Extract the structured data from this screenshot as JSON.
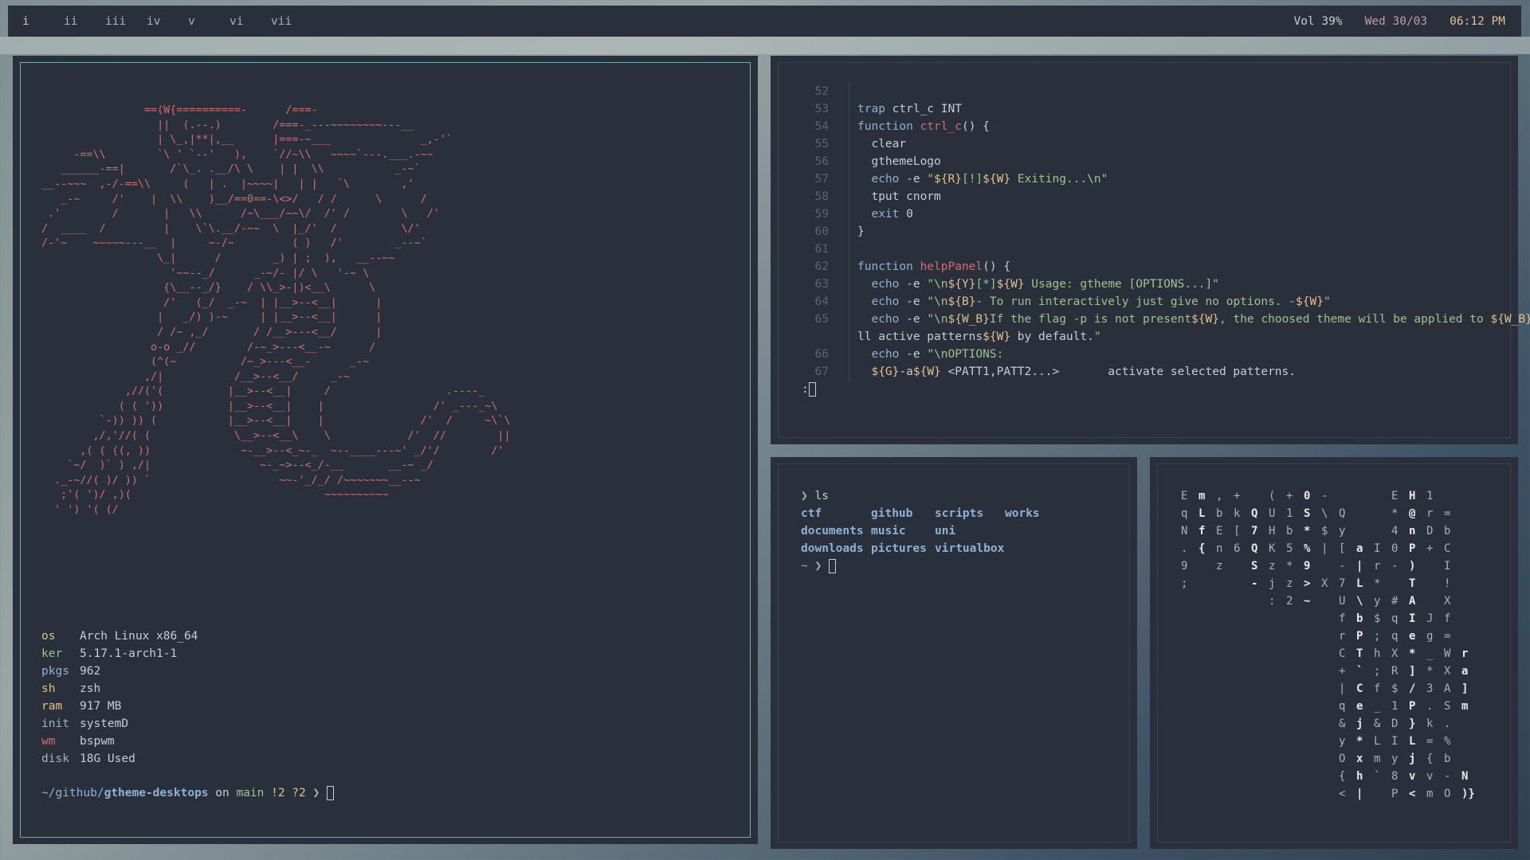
{
  "bar": {
    "workspaces": [
      "i",
      "ii",
      "iii",
      "iv",
      "v",
      "vi",
      "vii"
    ],
    "active_workspace": "i",
    "volume": "Vol 39%",
    "date": "Wed 30/03",
    "time": "06:12 PM"
  },
  "colors": {
    "accent_red": "#d36b73",
    "accent_yellow": "#e2c08d",
    "accent_blue": "#8fb1d4",
    "accent_green": "#9fc28a",
    "bg": "#29303b"
  },
  "fetch": {
    "ascii_art": "                ==(W{==========-      /===-\n                  ||  (.--.)        /===-_---~~~~~~~~---__\n                  | \\_,|**|,__      |===-~___              _,-'`\n     -==\\\\        `\\ ' `--'   ),    `//~\\\\   ~~~~`---.___.-~~\n   ______-==|       /`\\_. .__/\\ \\    | |  \\\\           _-~`\n__--~~~  ,-/-==\\\\     (   | .  |~~~~|   | |   `\\        ,'\n   _-~     /'    |  \\\\    )__/==0==-\\<>/   / /      \\      /\n .'        /       |   \\\\      /~\\___/~~\\/  /' /        \\   /'\n/  ____  /         |    \\`\\.__/-~~  \\  |_/'  /          \\/'\n/-'~    ~~~~~---__  |     ~-/~         ( )   /'        _--~`\n                  \\_|      /        _) | ;  ),   __--~~\n                    '~~--_/      _-~/- |/ \\   '-~ \\\n                   {\\__--_/}    / \\\\_>-|)<__\\      \\\n                   /'   (_/  _-~  | |__>--<__|      |\n                  |   _/) )-~     | |__>--<__|      |\n                  / /~ ,_/       / /__>---<__/      |\n                 o-o _//        /-~_>---<__-~      /\n                 (^(~          /~_>---<__-      _-~\n                ,/|           /__>--<__/     _-~\n             ,//('(          |__>--<__|     /                  .----_\n            ( ( '))          |__>--<__|    |                 /' _---_~\\\n         `-)) )) (           |__>--<__|    |               /'  /     ~\\`\\\n        ,/,'//( (             \\__>--<__\\    \\            /'  //        ||\n      ,( ( ((, ))              ~-__>--<_~-_  ~--____---~' _/'/        /'\n    `~/  )` ) ,/|                 ~-_~>--<_/-__       __-~ _/\n  ._-~//( )/ )) `                    ~~-'_/_/ /~~~~~~~__--~\n   ;'( ')/ ,)(                              ~~~~~~~~~~\n  ' ') '( (/",
    "rows": [
      {
        "key": "os",
        "value": "Arch Linux x86_64"
      },
      {
        "key": "ker",
        "value": "5.17.1-arch1-1"
      },
      {
        "key": "pkgs",
        "value": "962"
      },
      {
        "key": "sh",
        "value": "zsh"
      },
      {
        "key": "ram",
        "value": "917 MB"
      },
      {
        "key": "init",
        "value": "systemD"
      },
      {
        "key": "wm",
        "value": "bspwm"
      },
      {
        "key": "disk",
        "value": "18G Used"
      }
    ],
    "prompt": {
      "path_prefix": "~/github/",
      "path_dir": "gtheme-desktops",
      "on": " on ",
      "branch": "main",
      "status": " !2 ?2 ",
      "arrow": "❯ "
    }
  },
  "editor": {
    "lines": [
      {
        "n": "52",
        "t": ""
      },
      {
        "n": "53",
        "t": "trap ctrl_c INT"
      },
      {
        "n": "54",
        "t": "function ctrl_c() {"
      },
      {
        "n": "55",
        "t": "  clear"
      },
      {
        "n": "56",
        "t": "  gthemeLogo"
      },
      {
        "n": "57",
        "t": "  echo -e \"${R}[!]${W} Exiting...\\n\""
      },
      {
        "n": "58",
        "t": "  tput cnorm"
      },
      {
        "n": "59",
        "t": "  exit 0"
      },
      {
        "n": "60",
        "t": "}"
      },
      {
        "n": "61",
        "t": ""
      },
      {
        "n": "62",
        "t": "function helpPanel() {"
      },
      {
        "n": "63",
        "t": "  echo -e \"\\n${Y}[*]${W} Usage: gtheme [OPTIONS...]\""
      },
      {
        "n": "64",
        "t": "  echo -e \"\\n${B}- To run interactively just give no options. -${W}\""
      },
      {
        "n": "65",
        "t": "  echo -e \"\\n${W_B}If the flag -p is not present${W}, the choosed theme will be applied to ${W_B}a"
      },
      {
        "n": "",
        "t": "ll active patterns${W} by default.\""
      },
      {
        "n": "66",
        "t": "  echo -e \"\\nOPTIONS:"
      },
      {
        "n": "67",
        "t": "  ${G}-a${W} <PATT1,PATT2...>       activate selected patterns."
      }
    ],
    "command_prompt": ":"
  },
  "ls_terminal": {
    "prompt": "❯ ",
    "command": "ls",
    "entries": [
      "ctf",
      "github",
      "scripts",
      "works",
      "documents",
      "music",
      "uni",
      "",
      "downloads",
      "pictures",
      "virtualbox",
      ""
    ],
    "end_prompt": "~ ❯ "
  },
  "matrix": {
    "columns": [
      "E\nq\nN\n.\n9\n;",
      "m\nL\nf\n{\n\n",
      ",\nb\nE\nn\nz",
      "+\nk\n[\n6\n",
      "\nQ\n7\nQ\nS\n-",
      "(\nU\nH\nK\nz\nj\n:",
      "+\n1\nb\n5\n*\nz\n2",
      "0\nS\n*\n%\n9\n>\n~",
      "-\n\\\n$\n|\n\nX\n",
      "\nQ\ny\n[\n-\n7\nU\nf\nr\nC\n+\n|\nq\n&\ny\nO\n{\n<",
      "\n\n\na\n|\nL\n\\\nb\nP\nT\n`\nC\ne\nj\n*\nx\nh\n|",
      "\n\n\nI\nr\n*\ny\n$\n;\nh\n;\nf\n_\n&\nL\nm\n`\n",
      "E\n*\n4\n0\n-\n\n#\nq\nq\nX\nR\n$\n1\nD\nI\ny\n8\nP",
      "H\n@\nn\nP\n)\nT\nA\nI\ne\n*\n]\n/\nP\n}\nL\nj\nv\n<",
      "1\nr\nD\n+\n\n\n\nJ\ng\n_\n*\n3\n.\nk\n=\n{\nv\nm",
      "\n=\nb\nC\nI\n!\nX\nf\n=\nW\nX\nA\nS\n.\n%\nb\n-\nO",
      "\n\n\n\n\n\n\n\n\nr\na\n]\nm\n\n\n\nN\n)}"
    ]
  }
}
